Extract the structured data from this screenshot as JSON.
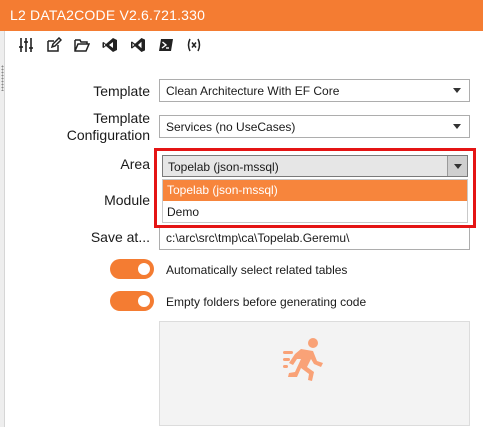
{
  "window": {
    "title": "L2 DATA2CODE V2.6.721.330"
  },
  "toolbar": {
    "icons": [
      "sliders-icon",
      "edit-icon",
      "folder-open-icon",
      "visual-studio-icon",
      "vscode-icon",
      "powershell-icon",
      "variable-icon"
    ]
  },
  "form": {
    "template_label": "Template",
    "template_value": "Clean Architecture With EF Core",
    "config_label_line1": "Template",
    "config_label_line2": "Configuration",
    "config_value": "Services (no UseCases)",
    "area_label": "Area",
    "area_value": "Topelab (json-mssql)",
    "area_options": [
      "Topelab (json-mssql)",
      "Demo"
    ],
    "module_label": "Module",
    "saveat_label": "Save at...",
    "saveat_value": "c:\\arc\\src\\tmp\\ca\\Topelab.Geremu\\"
  },
  "toggles": {
    "auto_select_label": "Automatically select related tables",
    "auto_select_on": true,
    "empty_folders_label": "Empty folders before generating code",
    "empty_folders_on": true
  },
  "colors": {
    "accent": "#f47c32",
    "highlight": "#e41414",
    "selected": "#f7853c"
  }
}
